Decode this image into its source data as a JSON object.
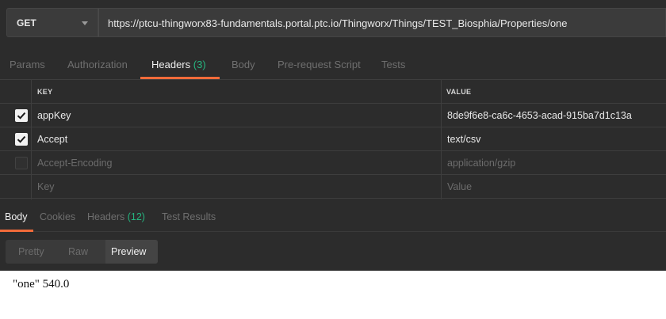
{
  "request": {
    "method": "GET",
    "url": "https://ptcu-thingworx83-fundamentals.portal.ptc.io/Thingworx/Things/TEST_Biosphia/Properties/one"
  },
  "request_tabs": {
    "params": "Params",
    "authorization": "Authorization",
    "headers": "Headers",
    "headers_count": "(3)",
    "body": "Body",
    "prerequest": "Pre-request Script",
    "tests": "Tests"
  },
  "headers_table": {
    "key_col": "KEY",
    "value_col": "VALUE",
    "rows": [
      {
        "key": "appKey",
        "value": "8de9f6e8-ca6c-4653-acad-915ba7d1c13a",
        "checked": true
      },
      {
        "key": "Accept",
        "value": "text/csv",
        "checked": true
      },
      {
        "key": "Accept-Encoding",
        "value": "application/gzip",
        "checked": false
      }
    ],
    "new_row": {
      "key_placeholder": "Key",
      "value_placeholder": "Value"
    }
  },
  "response_tabs": {
    "body": "Body",
    "cookies": "Cookies",
    "headers": "Headers",
    "headers_count": "(12)",
    "test_results": "Test Results"
  },
  "view_toggle": {
    "pretty": "Pretty",
    "raw": "Raw",
    "preview": "Preview",
    "selected": "Preview"
  },
  "response_preview": "\"one\" 540.0",
  "colors": {
    "accent": "#f26b3a",
    "count": "#26b47f",
    "background": "#2c2c2c"
  }
}
